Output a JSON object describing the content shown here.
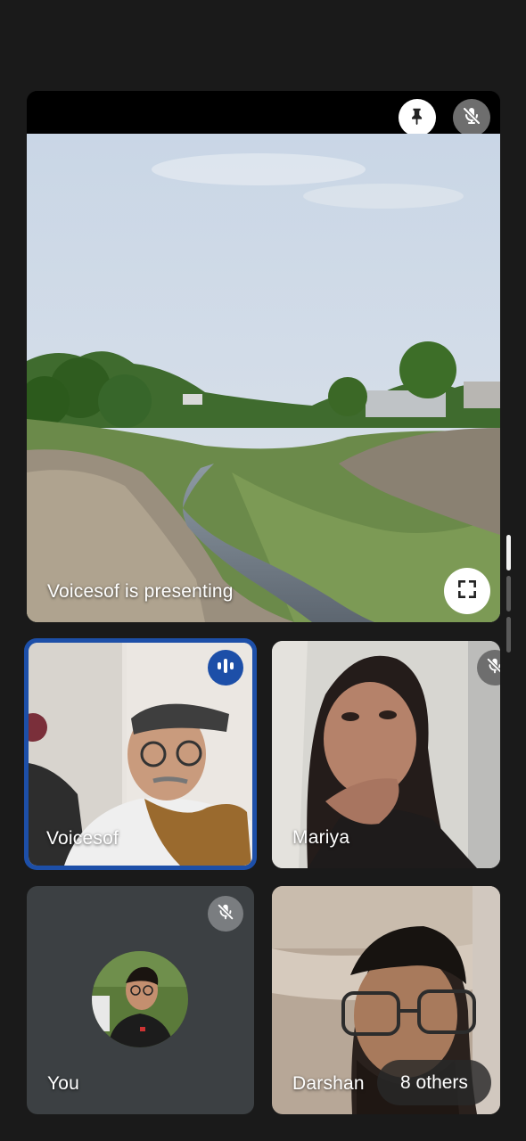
{
  "presentation": {
    "status": "Voicesof is presenting"
  },
  "participants": [
    {
      "name": "Voicesof",
      "state": "speaking"
    },
    {
      "name": "Mariya",
      "state": "muted"
    },
    {
      "name": "You",
      "state": "muted"
    },
    {
      "name": "Darshan",
      "state": "unmuted"
    }
  ],
  "others": {
    "label": "8 others"
  },
  "icons": [
    "pin-icon",
    "mic-off-icon",
    "fullscreen-icon",
    "speaking-icon"
  ],
  "colors": {
    "background": "#1a1a1a",
    "speaking_border": "#1d4fa8",
    "self_tile": "#3c4043"
  }
}
